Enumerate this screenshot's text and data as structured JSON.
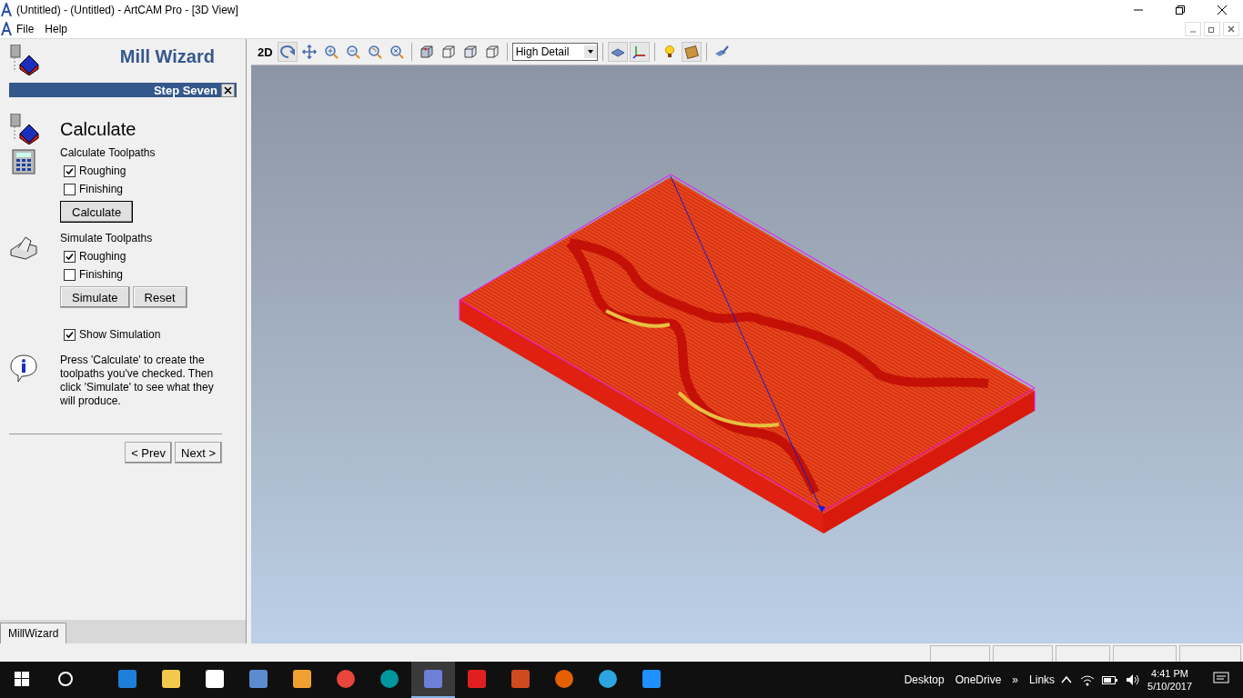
{
  "window": {
    "title": "(Untitled) - (Untitled) - ArtCAM Pro - [3D View]"
  },
  "menu": [
    "File",
    "Help"
  ],
  "wizard": {
    "title": "Mill Wizard",
    "step": "Step Seven",
    "heading": "Calculate",
    "calculate_section": {
      "title": "Calculate Toolpaths",
      "options": [
        {
          "label": "Roughing",
          "checked": true
        },
        {
          "label": "Finishing",
          "checked": false
        }
      ],
      "buttons": [
        "Calculate"
      ]
    },
    "simulate_section": {
      "title": "Simulate Toolpaths",
      "options": [
        {
          "label": "Roughing",
          "checked": true
        },
        {
          "label": "Finishing",
          "checked": false
        }
      ],
      "buttons": [
        "Simulate",
        "Reset"
      ]
    },
    "show_simulation": {
      "label": "Show Simulation",
      "checked": true
    },
    "info": "Press 'Calculate' to create the toolpaths you've checked. Then click 'Simulate' to see what they will produce.",
    "nav": [
      "< Prev",
      "Next >"
    ],
    "tab": "MillWizard"
  },
  "toolbar": {
    "label_2d": "2D",
    "view_tools": [
      {
        "selected": true
      },
      {
        "selected": false
      },
      {
        "selected": false
      },
      {
        "selected": false
      },
      {
        "selected": false
      },
      {
        "selected": false
      }
    ],
    "view_cubes": [
      {
        "selected": false
      },
      {
        "selected": false
      },
      {
        "selected": false
      },
      {
        "selected": false
      }
    ],
    "detail": "High Detail",
    "display_tools": [
      {
        "selected": true
      },
      {
        "selected": true
      }
    ],
    "light_tools": [
      {
        "selected": false
      },
      {
        "selected": true
      }
    ],
    "paint_tools": [
      {
        "selected": false
      }
    ]
  },
  "taskbar": {
    "apps": [
      {
        "selected": false
      },
      {
        "selected": false
      },
      {
        "selected": false
      },
      {
        "selected": false
      },
      {
        "selected": false
      },
      {
        "selected": false
      },
      {
        "selected": false
      },
      {
        "selected": true
      },
      {
        "selected": false
      },
      {
        "selected": false
      },
      {
        "selected": false
      },
      {
        "selected": false
      },
      {
        "selected": false
      }
    ],
    "toolbars": [
      "Desktop",
      "OneDrive",
      "»",
      "Links"
    ],
    "time": "4:41 PM",
    "date": "5/10/2017"
  }
}
